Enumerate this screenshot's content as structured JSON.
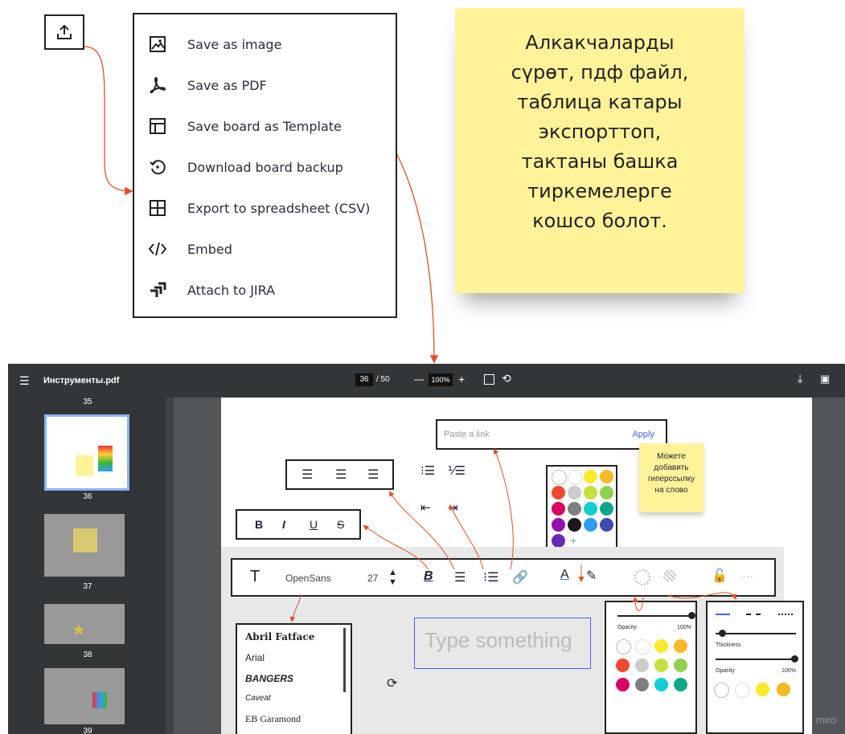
{
  "menu": {
    "items": [
      {
        "label": "Save as image",
        "icon": "image-icon"
      },
      {
        "label": "Save as PDF",
        "icon": "pdf-icon"
      },
      {
        "label": "Save board as Template",
        "icon": "template-icon"
      },
      {
        "label": "Download board backup",
        "icon": "backup-icon"
      },
      {
        "label": "Export to spreadsheet (CSV)",
        "icon": "grid-icon"
      },
      {
        "label": "Embed",
        "icon": "code-icon"
      },
      {
        "label": "Attach to JIRA",
        "icon": "jira-icon"
      }
    ]
  },
  "sticky": {
    "text": "Алкакчаларды\nсүрөт, пдф файл,\nтаблица катары\nэкспорттоп,\nтактаны  башка\nтиркемелерге\nкошсо болот."
  },
  "viewer": {
    "title": "Инструменты.pdf",
    "page_current": "36",
    "page_total": "/ 50",
    "zoom": "100%",
    "zoom_minus": "—",
    "zoom_plus": "+",
    "thumbs": [
      {
        "num": "36"
      },
      {
        "num": "37"
      },
      {
        "num": "38"
      },
      {
        "num": "39"
      }
    ],
    "top_page_num": "35"
  },
  "content": {
    "link_placeholder": "Paste a link",
    "apply": "Apply",
    "sticky_small": "Можете\nдобавить\nгиперссылку\nна слово",
    "font_name": "OpenSans",
    "font_size": "27",
    "fonts": [
      "Abril Fatface",
      "Arial",
      "BANGERS",
      "Caveat",
      "EB Garamond"
    ],
    "placeholder": "Type something",
    "opacity": "Opacity",
    "opacity_val": "100%",
    "thickness": "Thickness",
    "opacity2": "Opacity",
    "opacity2_val": "100%",
    "watermark": "miro"
  },
  "colors": {
    "accent_red": "#e0502a",
    "sticky_yellow": "#fff39a",
    "viewer_dark": "#323639"
  }
}
